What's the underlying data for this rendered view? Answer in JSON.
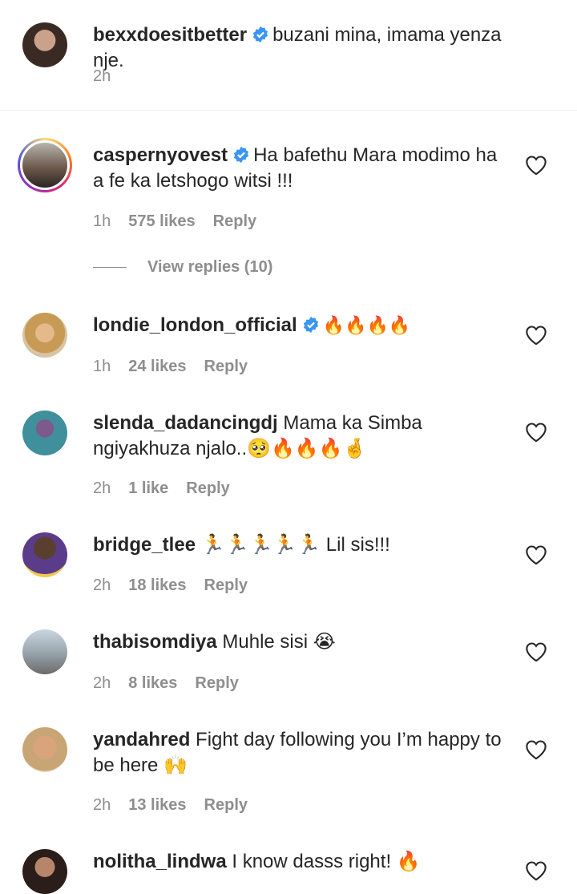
{
  "comments": [
    {
      "username": "bexxdoesitbetter",
      "verified": true,
      "text": "buzani mina, imama yenza nje.",
      "time": "2h",
      "likes": "",
      "reply": ""
    },
    {
      "username": "caspernyovest",
      "verified": true,
      "text": "Ha bafethu Mara modimo ha a fe ka letshogo witsi !!!",
      "time": "1h",
      "likes": "575 likes",
      "reply": "Reply"
    },
    {
      "username": "londie_london_official",
      "verified": true,
      "text": "🔥🔥🔥🔥",
      "time": "1h",
      "likes": "24 likes",
      "reply": "Reply"
    },
    {
      "username": "slenda_dadancingdj",
      "verified": false,
      "text": "Mama ka Simba ngiyakhuza njalo..🥺🔥🔥🔥🤞",
      "time": "2h",
      "likes": "1 like",
      "reply": "Reply"
    },
    {
      "username": "bridge_tlee",
      "verified": false,
      "text": "🏃🏃🏃🏃🏃 Lil sis!!!",
      "time": "2h",
      "likes": "18 likes",
      "reply": "Reply"
    },
    {
      "username": "thabisomdiya",
      "verified": false,
      "text": "Muhle sisi 😭",
      "time": "2h",
      "likes": "8 likes",
      "reply": "Reply"
    },
    {
      "username": "yandahred",
      "verified": false,
      "text": "Fight day following you I’m happy to be here 🙌",
      "time": "2h",
      "likes": "13 likes",
      "reply": "Reply"
    },
    {
      "username": "nolitha_lindwa",
      "verified": false,
      "text": "I know dasss right! 🔥",
      "time": "",
      "likes": "",
      "reply": ""
    }
  ],
  "view_replies": "View replies (10)",
  "colors": {
    "verified": "#3897f0",
    "meta": "#8e8e8e",
    "text": "#262626"
  }
}
